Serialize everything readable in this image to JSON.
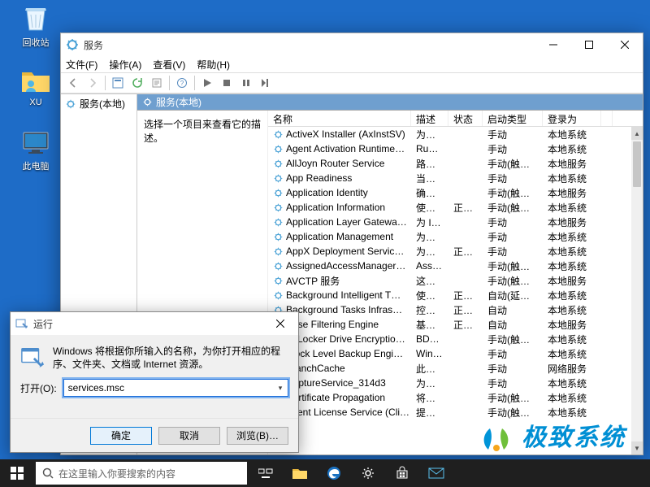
{
  "desktop": {
    "icons": [
      {
        "label": "回收站"
      },
      {
        "label": "XU"
      },
      {
        "label": "此电脑"
      }
    ]
  },
  "services_window": {
    "title": "服务",
    "menubar": [
      "文件(F)",
      "操作(A)",
      "查看(V)",
      "帮助(H)"
    ],
    "tree_label": "服务(本地)",
    "header_label": "服务(本地)",
    "left_hint": "选择一个项目来查看它的描述。",
    "columns": [
      "名称",
      "描述",
      "状态",
      "启动类型",
      "登录为"
    ],
    "rows": [
      {
        "name": "ActiveX Installer (AxInstSV)",
        "desc": "为从…",
        "status": "",
        "start": "手动",
        "logon": "本地系统"
      },
      {
        "name": "Agent Activation Runtime…",
        "desc": "Runt…",
        "status": "",
        "start": "手动",
        "logon": "本地系统"
      },
      {
        "name": "AllJoyn Router Service",
        "desc": "路由…",
        "status": "",
        "start": "手动(触发…",
        "logon": "本地服务"
      },
      {
        "name": "App Readiness",
        "desc": "当用…",
        "status": "",
        "start": "手动",
        "logon": "本地系统"
      },
      {
        "name": "Application Identity",
        "desc": "确定…",
        "status": "",
        "start": "手动(触发…",
        "logon": "本地服务"
      },
      {
        "name": "Application Information",
        "desc": "使用…",
        "status": "正在…",
        "start": "手动(触发…",
        "logon": "本地系统"
      },
      {
        "name": "Application Layer Gatewa…",
        "desc": "为 In…",
        "status": "",
        "start": "手动",
        "logon": "本地服务"
      },
      {
        "name": "Application Management",
        "desc": "为通…",
        "status": "",
        "start": "手动",
        "logon": "本地系统"
      },
      {
        "name": "AppX Deployment Servic…",
        "desc": "为部…",
        "status": "正在…",
        "start": "手动",
        "logon": "本地系统"
      },
      {
        "name": "AssignedAccessManager…",
        "desc": "Assi…",
        "status": "",
        "start": "手动(触发…",
        "logon": "本地系统"
      },
      {
        "name": "AVCTP 服务",
        "desc": "这是…",
        "status": "",
        "start": "手动(触发…",
        "logon": "本地服务"
      },
      {
        "name": "Background Intelligent T…",
        "desc": "使用…",
        "status": "正在…",
        "start": "自动(延迟…",
        "logon": "本地系统"
      },
      {
        "name": "Background Tasks Infras…",
        "desc": "控制…",
        "status": "正在…",
        "start": "自动",
        "logon": "本地系统"
      },
      {
        "name": "Base Filtering Engine",
        "desc": "基本…",
        "status": "正在…",
        "start": "自动",
        "logon": "本地服务"
      },
      {
        "name": "BitLocker Drive Encryptio…",
        "desc": "BDE…",
        "status": "",
        "start": "手动(触发…",
        "logon": "本地系统"
      },
      {
        "name": "Block Level Backup Engi…",
        "desc": "Win…",
        "status": "",
        "start": "手动",
        "logon": "本地系统"
      },
      {
        "name": "BranchCache",
        "desc": "此服…",
        "status": "",
        "start": "手动",
        "logon": "网络服务"
      },
      {
        "name": "CaptureService_314d3",
        "desc": "为调…",
        "status": "",
        "start": "手动",
        "logon": "本地系统"
      },
      {
        "name": "Certificate Propagation",
        "desc": "将用…",
        "status": "",
        "start": "手动(触发…",
        "logon": "本地系统"
      },
      {
        "name": "Client License Service (Cli…",
        "desc": "提供…",
        "status": "",
        "start": "手动(触发…",
        "logon": "本地系统"
      }
    ]
  },
  "run_dialog": {
    "title": "运行",
    "text": "Windows 将根据你所输入的名称，为你打开相应的程序、文件夹、文档或 Internet 资源。",
    "open_label": "打开(O):",
    "value": "services.msc",
    "buttons": {
      "ok": "确定",
      "cancel": "取消",
      "browse": "浏览(B)…"
    }
  },
  "taskbar": {
    "search_placeholder": "在这里输入你要搜索的内容"
  },
  "watermark": {
    "text": "极致系统"
  }
}
